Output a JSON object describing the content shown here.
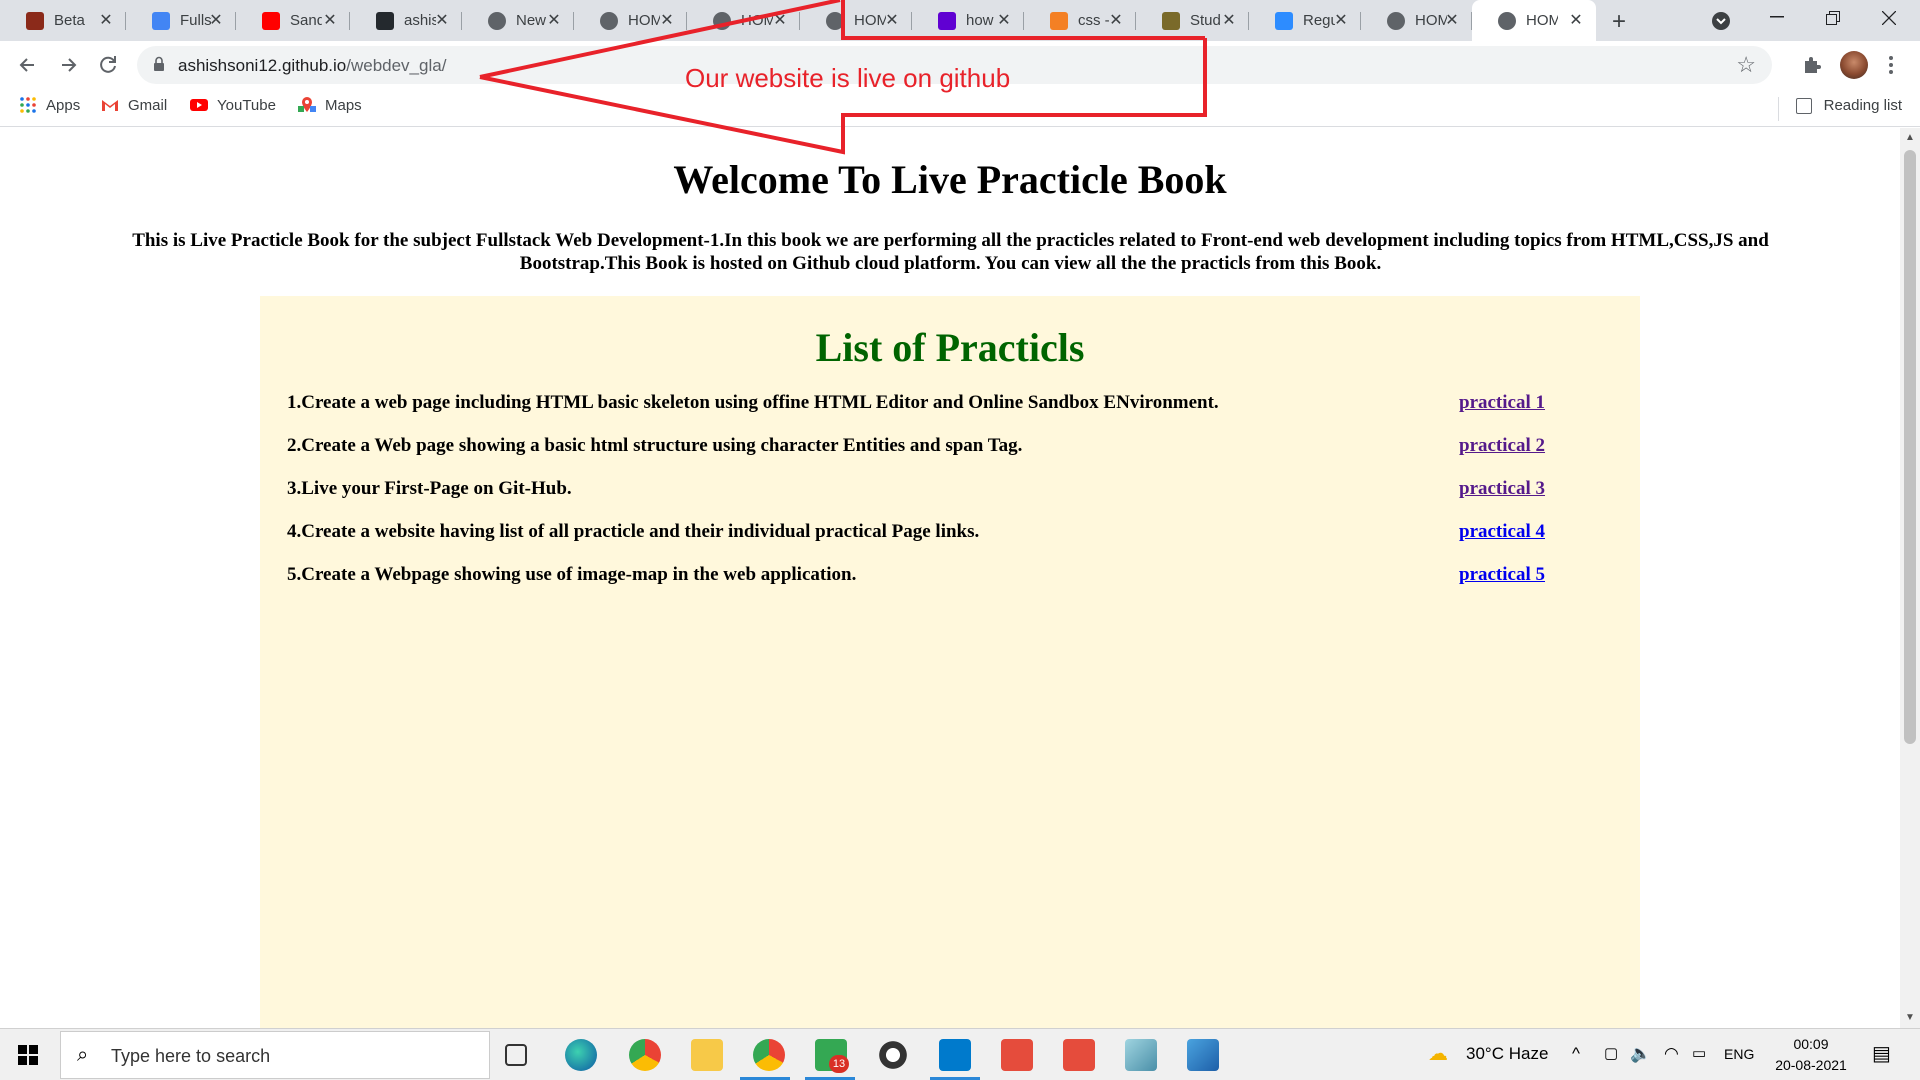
{
  "browser": {
    "tabs": [
      {
        "title": "Beta",
        "favicon_color": "#8b2a1a"
      },
      {
        "title": "Fullst",
        "favicon_color": "#4285f4"
      },
      {
        "title": "Sand",
        "favicon_color": "#ff0000"
      },
      {
        "title": "ashis",
        "favicon_color": "#24292e"
      },
      {
        "title": "New",
        "favicon_color": "#5f6368"
      },
      {
        "title": "HOM",
        "favicon_color": "#5f6368"
      },
      {
        "title": "HOM",
        "favicon_color": "#5f6368"
      },
      {
        "title": "HOM",
        "favicon_color": "#5f6368"
      },
      {
        "title": "how",
        "favicon_color": "#6001d2"
      },
      {
        "title": "css -",
        "favicon_color": "#f48024"
      },
      {
        "title": "Stud",
        "favicon_color": "#7a6a2a"
      },
      {
        "title": "Regu",
        "favicon_color": "#2d8cff"
      },
      {
        "title": "HOM",
        "favicon_color": "#5f6368"
      },
      {
        "title": "HOM",
        "favicon_color": "#5f6368"
      }
    ],
    "new_tab": "+",
    "address": {
      "host": "ashishsoni12.github.io",
      "path": "/webdev_gla/"
    },
    "bookmarks": [
      {
        "label": "Apps",
        "icon": "apps-grid-icon"
      },
      {
        "label": "Gmail",
        "icon": "gmail-icon"
      },
      {
        "label": "YouTube",
        "icon": "youtube-icon"
      },
      {
        "label": "Maps",
        "icon": "maps-icon"
      }
    ],
    "reading_list": "Reading list"
  },
  "annotation": {
    "text": "Our website is live on github",
    "color": "#e8222a"
  },
  "page": {
    "heading": "Welcome To Live Practicle Book",
    "intro": "This is Live Practicle Book for the subject Fullstack Web Development-1.In this book we are performing all the practicles related to Front-end web development including topics from HTML,CSS,JS and Bootstrap.This Book is hosted on Github cloud platform. You can view all the the practicls from this Book.",
    "list_title": "List of Practicls",
    "panel_color": "#fff8dc",
    "practicals": [
      {
        "text": "1.Create a web page including HTML basic skeleton using offine HTML Editor and Online Sandbox ENvironment.",
        "link": "practical 1",
        "visited": true
      },
      {
        "text": "2.Create a Web page showing a basic html structure using character Entities and span Tag.",
        "link": "practical 2",
        "visited": true
      },
      {
        "text": "3.Live your First-Page on Git-Hub.",
        "link": "practical 3",
        "visited": true
      },
      {
        "text": "4.Create a website having list of all practicle and their individual practical Page links.",
        "link": "practical 4",
        "visited": false
      },
      {
        "text": "5.Create a Webpage showing use of image-map in the web application.",
        "link": "practical 5",
        "visited": false
      }
    ]
  },
  "taskbar": {
    "search_placeholder": "Type here to search",
    "badge": "13",
    "weather": "30°C  Haze",
    "language": "ENG",
    "time": "00:09",
    "date": "20-08-2021"
  }
}
